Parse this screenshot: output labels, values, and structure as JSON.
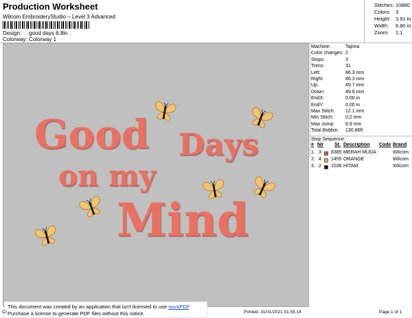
{
  "header": {
    "title": "Production Worksheet",
    "subtitle": "Wilcom EmbroideryStudio – Level 3 Advanced",
    "design_label": "Design:",
    "design_value": "good days 6.8in",
    "colorway_label": "Colorway:",
    "colorway_value": "Colorway 1"
  },
  "summary": [
    {
      "k": "Stitches:",
      "v": "10880"
    },
    {
      "k": "Colors:",
      "v": "3"
    },
    {
      "k": "Height:",
      "v": "3.91 in"
    },
    {
      "k": "Width:",
      "v": "6.80 in"
    },
    {
      "k": "Zoom:",
      "v": "1:1"
    }
  ],
  "stats": [
    {
      "k": "Machine:",
      "v": "Tajima"
    },
    {
      "k": "Color changes:",
      "v": "2"
    },
    {
      "k": "Stops:",
      "v": "3"
    },
    {
      "k": "Trims:",
      "v": "31"
    },
    {
      "k": "Left:",
      "v": "86.3 mm"
    },
    {
      "k": "Right:",
      "v": "86.3 mm"
    },
    {
      "k": "Up:",
      "v": "49.7 mm"
    },
    {
      "k": "Down:",
      "v": "49.6 mm"
    },
    {
      "k": "EndX:",
      "v": "0.00 in"
    },
    {
      "k": "EndY:",
      "v": "0.00 in"
    },
    {
      "k": "Max Stitch:",
      "v": "12.1 mm"
    },
    {
      "k": "Min Stitch:",
      "v": "0.2 mm"
    },
    {
      "k": "Max Jump:",
      "v": "6.9 mm"
    },
    {
      "k": "Total Bobbin:",
      "v": "130.86ft"
    }
  ],
  "stop_sequence": {
    "title": "Stop Sequence:",
    "columns": {
      "num": "#",
      "n": "N#",
      "st": "St.",
      "desc": "Description",
      "code": "Code",
      "brand": "Brand"
    },
    "rows": [
      {
        "num": "1.",
        "n": "3",
        "color": "#e9574f",
        "st": "8385",
        "desc": "MERAH MUDA",
        "code": "",
        "brand": "Wilcom"
      },
      {
        "num": "2.",
        "n": "4",
        "color": "#f4b24a",
        "st": "1455",
        "desc": "ORANGE",
        "code": "",
        "brand": "Wilcom"
      },
      {
        "num": "3.",
        "n": "2",
        "color": "#111111",
        "st": "1038",
        "desc": "HITAM",
        "code": "",
        "brand": "Wilcom"
      }
    ]
  },
  "design_text": {
    "line1a": "Good",
    "line1b": "Days",
    "line2": "on my",
    "line3": "Mind"
  },
  "colors": {
    "canvas_bg": "#c0c0c0",
    "thread_pink": "#ea6f62",
    "thread_pink_shadow": "#b8473d",
    "thread_orange": "#f2c46c",
    "thread_black": "#1a1a1a"
  },
  "notice": {
    "line1_pre": "This document was created by an application that isn't licensed to use ",
    "link": "novaPDF",
    "line1_post": ".",
    "line2": "Purchase a license to generate PDF files without this notice."
  },
  "footer": {
    "left": "Cr",
    "printed": "Printed: 31/01/2021 01.55.18",
    "page": "Page 1 of 1"
  }
}
